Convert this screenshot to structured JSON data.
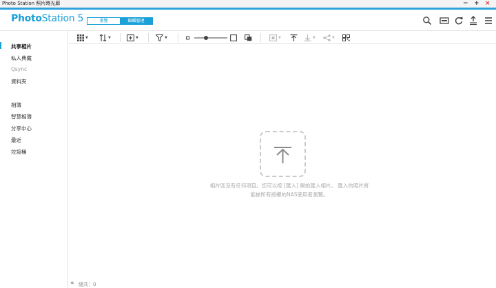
{
  "window": {
    "title": "Photo Station 照片時光廊",
    "controls": [
      "−",
      "+",
      "×"
    ]
  },
  "header": {
    "logo_bold": "Photo",
    "logo_light": "Station 5",
    "modes": [
      "瀏覽",
      "編輯管理"
    ],
    "active_mode": "編輯管理",
    "icons": [
      "search-icon",
      "slideshow-icon",
      "refresh-icon",
      "upload-icon",
      "menu-icon"
    ]
  },
  "sidebar": {
    "group1": [
      "共享相片",
      "私人典藏",
      "Qsync",
      "資料夾"
    ],
    "group2": [
      "相簿",
      "智慧相簿",
      "分享中心",
      "最近",
      "垃圾桶"
    ],
    "active": "共享相片"
  },
  "toolbar": {
    "icons": [
      "grid-view-icon",
      "sort-icon",
      "add-album-icon",
      "filter-icon",
      "zoom-small-icon",
      "zoom-slider",
      "zoom-large-icon",
      "select-icon",
      "slideshow-icon",
      "upload-icon",
      "download-icon",
      "share-icon",
      "qr-icon"
    ]
  },
  "empty_state": {
    "line1": "相片區沒有任何項目。您可以按 [匯入] 開始匯入相片。 匯入的照片將",
    "line2": "能被所有授權的NAS使用者瀏覽。"
  },
  "footer": {
    "collapse": "«",
    "count_label": "總共：0"
  },
  "colors": {
    "accent": "#1ba0d8",
    "text": "#333333",
    "muted": "#aaaaaa"
  }
}
